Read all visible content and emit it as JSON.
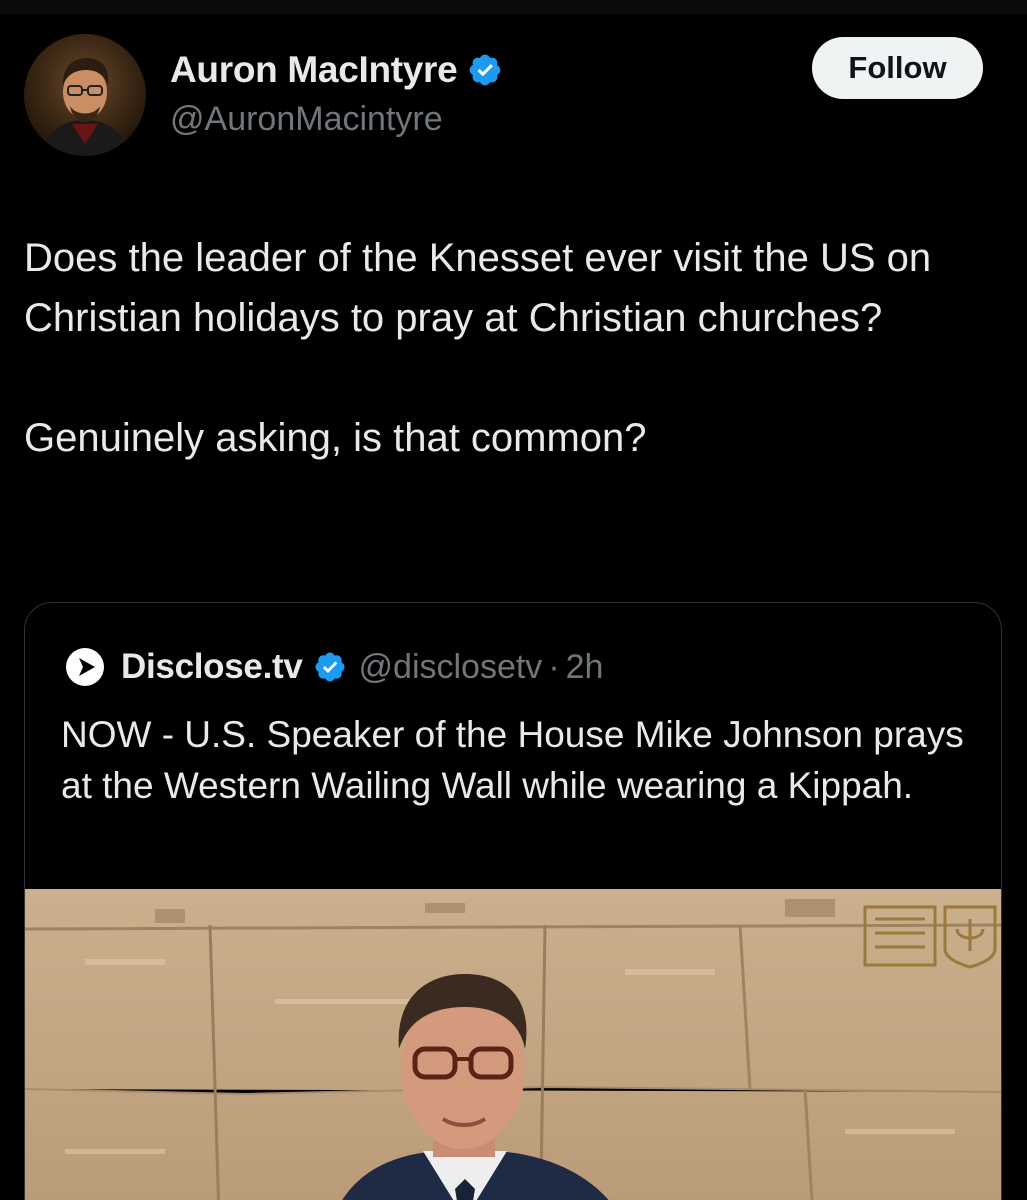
{
  "author": {
    "name": "Auron MacIntyre",
    "handle": "@AuronMacintyre",
    "verified": true,
    "avatar_icon": "profile-photo"
  },
  "follow_label": "Follow",
  "tweet": {
    "paragraphs": [
      "Does the leader of the Knesset ever visit the US on Christian holidays to pray at Christian churches?",
      "Genuinely asking, is that common?"
    ]
  },
  "quote": {
    "name": "Disclose.tv",
    "handle": "@disclosetv",
    "separator": "·",
    "time": "2h",
    "verified": true,
    "text": "NOW - U.S. Speaker of the House Mike Johnson prays at the Western Wailing Wall while wearing a Kippah.",
    "media": {
      "description_icon": "video-thumbnail",
      "emblem_icon": "knesset-emblem"
    }
  },
  "colors": {
    "background": "#000000",
    "text_primary": "#e7e9ea",
    "text_secondary": "#71767b",
    "verified_blue": "#1d9bf0",
    "border": "#2f3336",
    "button_bg": "#eff3f4"
  }
}
